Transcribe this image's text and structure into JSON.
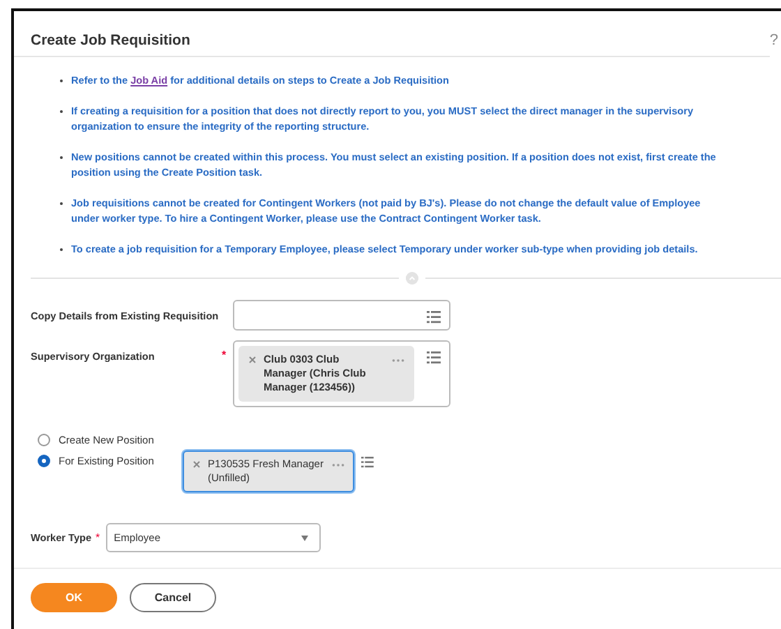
{
  "title": "Create Job Requisition",
  "help": "?",
  "notes": [
    {
      "before": "Refer to the ",
      "link": "Job Aid",
      "after": " for additional details on steps to Create a Job Requisition"
    },
    {
      "text": "If creating a requisition for a position that does not directly report to you, you MUST select the direct manager in the supervisory organization to ensure the integrity of the reporting structure."
    },
    {
      "text": "New positions cannot be created within this process. You must select an existing position. If a position does not exist, first create the position using the Create Position task."
    },
    {
      "text": "Job requisitions cannot be created for Contingent Workers (not paid by BJ's). Please do not change the default value of Employee under worker type. To hire a Contingent Worker, please use the Contract Contingent Worker task."
    },
    {
      "text": "To create a job requisition for a Temporary Employee, please select Temporary under worker sub-type when providing job details."
    }
  ],
  "copy_details": {
    "label": "Copy Details from Existing Requisition"
  },
  "supervisory_organization": {
    "label": "Supervisory Organization",
    "required_mark": "*",
    "token": "Club 0303 Club Manager (Chris Club Manager (123456))"
  },
  "position_options": [
    {
      "label": "Create New Position",
      "selected": false
    },
    {
      "label": "For Existing Position",
      "selected": true
    }
  ],
  "existing_position": {
    "token": "P130535 Fresh Manager (Unfilled)",
    "focused": true
  },
  "worker_type": {
    "label": "Worker Type",
    "required_mark": "*",
    "value": "Employee"
  },
  "buttons": [
    {
      "label": "OK",
      "kind": "primary"
    },
    {
      "label": "Cancel",
      "kind": "secondary"
    }
  ]
}
